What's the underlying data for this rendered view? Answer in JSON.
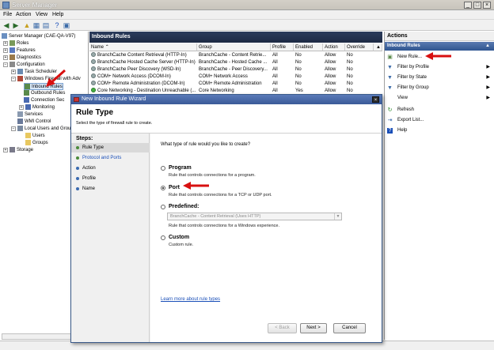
{
  "window": {
    "title": "Server Manager"
  },
  "menu": [
    "File",
    "Action",
    "View",
    "Help"
  ],
  "tree": [
    {
      "label": "Server Manager (CAE-QA-V97)",
      "level": 0
    },
    {
      "label": "Roles",
      "level": 1
    },
    {
      "label": "Features",
      "level": 1
    },
    {
      "label": "Diagnostics",
      "level": 1
    },
    {
      "label": "Configuration",
      "level": 1
    },
    {
      "label": "Task Scheduler",
      "level": 2
    },
    {
      "label": "Windows Firewall with Adv",
      "level": 2
    },
    {
      "label": "Inbound Rules",
      "level": 3,
      "selected": true
    },
    {
      "label": "Outbound Rules",
      "level": 3
    },
    {
      "label": "Connection Sec",
      "level": 3
    },
    {
      "label": "Monitoring",
      "level": 3
    },
    {
      "label": "Services",
      "level": 2
    },
    {
      "label": "WMI Control",
      "level": 2
    },
    {
      "label": "Local Users and Grou",
      "level": 2
    },
    {
      "label": "Users",
      "level": 3
    },
    {
      "label": "Groups",
      "level": 3
    },
    {
      "label": "Storage",
      "level": 1
    }
  ],
  "center": {
    "title": "Inbound Rules",
    "columns": [
      "Name",
      "Group",
      "Profile",
      "Enabled",
      "Action",
      "Override"
    ],
    "rows": [
      [
        "BranchCache Content Retrieval (HTTP-In)",
        "BranchCache - Content Retrie...",
        "All",
        "No",
        "Allow",
        "No"
      ],
      [
        "BranchCache Hosted Cache Server (HTTP-In)",
        "BranchCache - Hosted Cache ...",
        "All",
        "No",
        "Allow",
        "No"
      ],
      [
        "BranchCache Peer Discovery (WSD-In)",
        "BranchCache - Peer Discovery...",
        "All",
        "No",
        "Allow",
        "No"
      ],
      [
        "COM+ Network Access (DCOM-In)",
        "COM+ Network Access",
        "All",
        "No",
        "Allow",
        "No"
      ],
      [
        "COM+ Remote Administration (DCOM-In)",
        "COM+ Remote Administration",
        "All",
        "No",
        "Allow",
        "No"
      ],
      [
        "Core Networking - Destination Unreachable (...",
        "Core Networking",
        "All",
        "Yes",
        "Allow",
        "No"
      ]
    ]
  },
  "actions": {
    "header": "Actions",
    "section": "Inbound Rules",
    "items": [
      "New Rule...",
      "Filter by Profile",
      "Filter by State",
      "Filter by Group",
      "View",
      "Refresh",
      "Export List...",
      "Help"
    ]
  },
  "wizard": {
    "title": "New Inbound Rule Wizard",
    "heading": "Rule Type",
    "description": "Select the type of firewall rule to create.",
    "steps_title": "Steps:",
    "steps": [
      "Rule Type",
      "Protocol and Ports",
      "Action",
      "Profile",
      "Name"
    ],
    "question": "What type of rule would you like to create?",
    "options": [
      {
        "label": "Program",
        "desc": "Rule that controls connections for a program."
      },
      {
        "label": "Port",
        "desc": "Rule that controls connections for a TCP or UDP port."
      },
      {
        "label": "Predefined:",
        "desc": "Rule that controls connections for a Windows experience."
      },
      {
        "label": "Custom",
        "desc": "Custom rule."
      }
    ],
    "predefined_value": "BranchCache - Content Retrieval (Uses HTTP)",
    "learn_link": "Learn more about rule types",
    "back": "< Back",
    "next": "Next >",
    "cancel": "Cancel"
  }
}
